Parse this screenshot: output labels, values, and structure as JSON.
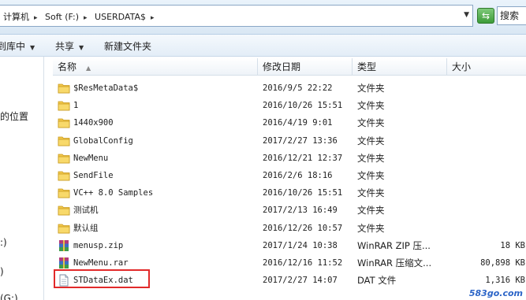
{
  "address_bar": {
    "breadcrumb": [
      "计算机",
      "Soft (F:)",
      "USERDATA$"
    ],
    "search_text": "搜索"
  },
  "toolbar": {
    "include_in_library": "到库中",
    "share": "共享",
    "new_folder": "新建文件夹"
  },
  "nav_pane": {
    "items": [
      "的位置",
      ":)",
      ")",
      "(G:)"
    ]
  },
  "columns": {
    "name": "名称",
    "date": "修改日期",
    "type": "类型",
    "size": "大小"
  },
  "files": [
    {
      "name": "$ResMetaData$",
      "date": "2016/9/5 22:22",
      "type": "文件夹",
      "size": "",
      "icon": "folder-icon"
    },
    {
      "name": "1",
      "date": "2016/10/26 15:51",
      "type": "文件夹",
      "size": "",
      "icon": "folder-icon"
    },
    {
      "name": "1440x900",
      "date": "2016/4/19 9:01",
      "type": "文件夹",
      "size": "",
      "icon": "folder-icon"
    },
    {
      "name": "GlobalConfig",
      "date": "2017/2/27 13:36",
      "type": "文件夹",
      "size": "",
      "icon": "folder-icon"
    },
    {
      "name": "NewMenu",
      "date": "2016/12/21 12:37",
      "type": "文件夹",
      "size": "",
      "icon": "folder-icon"
    },
    {
      "name": "SendFile",
      "date": "2016/2/6 18:16",
      "type": "文件夹",
      "size": "",
      "icon": "folder-icon"
    },
    {
      "name": "VC++ 8.0 Samples",
      "date": "2016/10/26 15:51",
      "type": "文件夹",
      "size": "",
      "icon": "folder-icon"
    },
    {
      "name": "测试机",
      "date": "2017/2/13 16:49",
      "type": "文件夹",
      "size": "",
      "icon": "folder-icon"
    },
    {
      "name": "默认组",
      "date": "2016/12/26 10:57",
      "type": "文件夹",
      "size": "",
      "icon": "folder-icon"
    },
    {
      "name": "menusp.zip",
      "date": "2017/1/24 10:38",
      "type": "WinRAR ZIP 压...",
      "size": "18 KB",
      "icon": "winrar-icon"
    },
    {
      "name": "NewMenu.rar",
      "date": "2016/12/16 11:52",
      "type": "WinRAR 压缩文...",
      "size": "80,898 KB",
      "icon": "winrar-icon"
    },
    {
      "name": "STDataEx.dat",
      "date": "2017/2/27 14:07",
      "type": "DAT 文件",
      "size": "1,316 KB",
      "icon": "file-icon"
    }
  ],
  "watermark": "583go.com",
  "colors": {
    "highlight": "#e22a2a",
    "folder": "#f2c84b",
    "watermark": "#2b64c7"
  }
}
